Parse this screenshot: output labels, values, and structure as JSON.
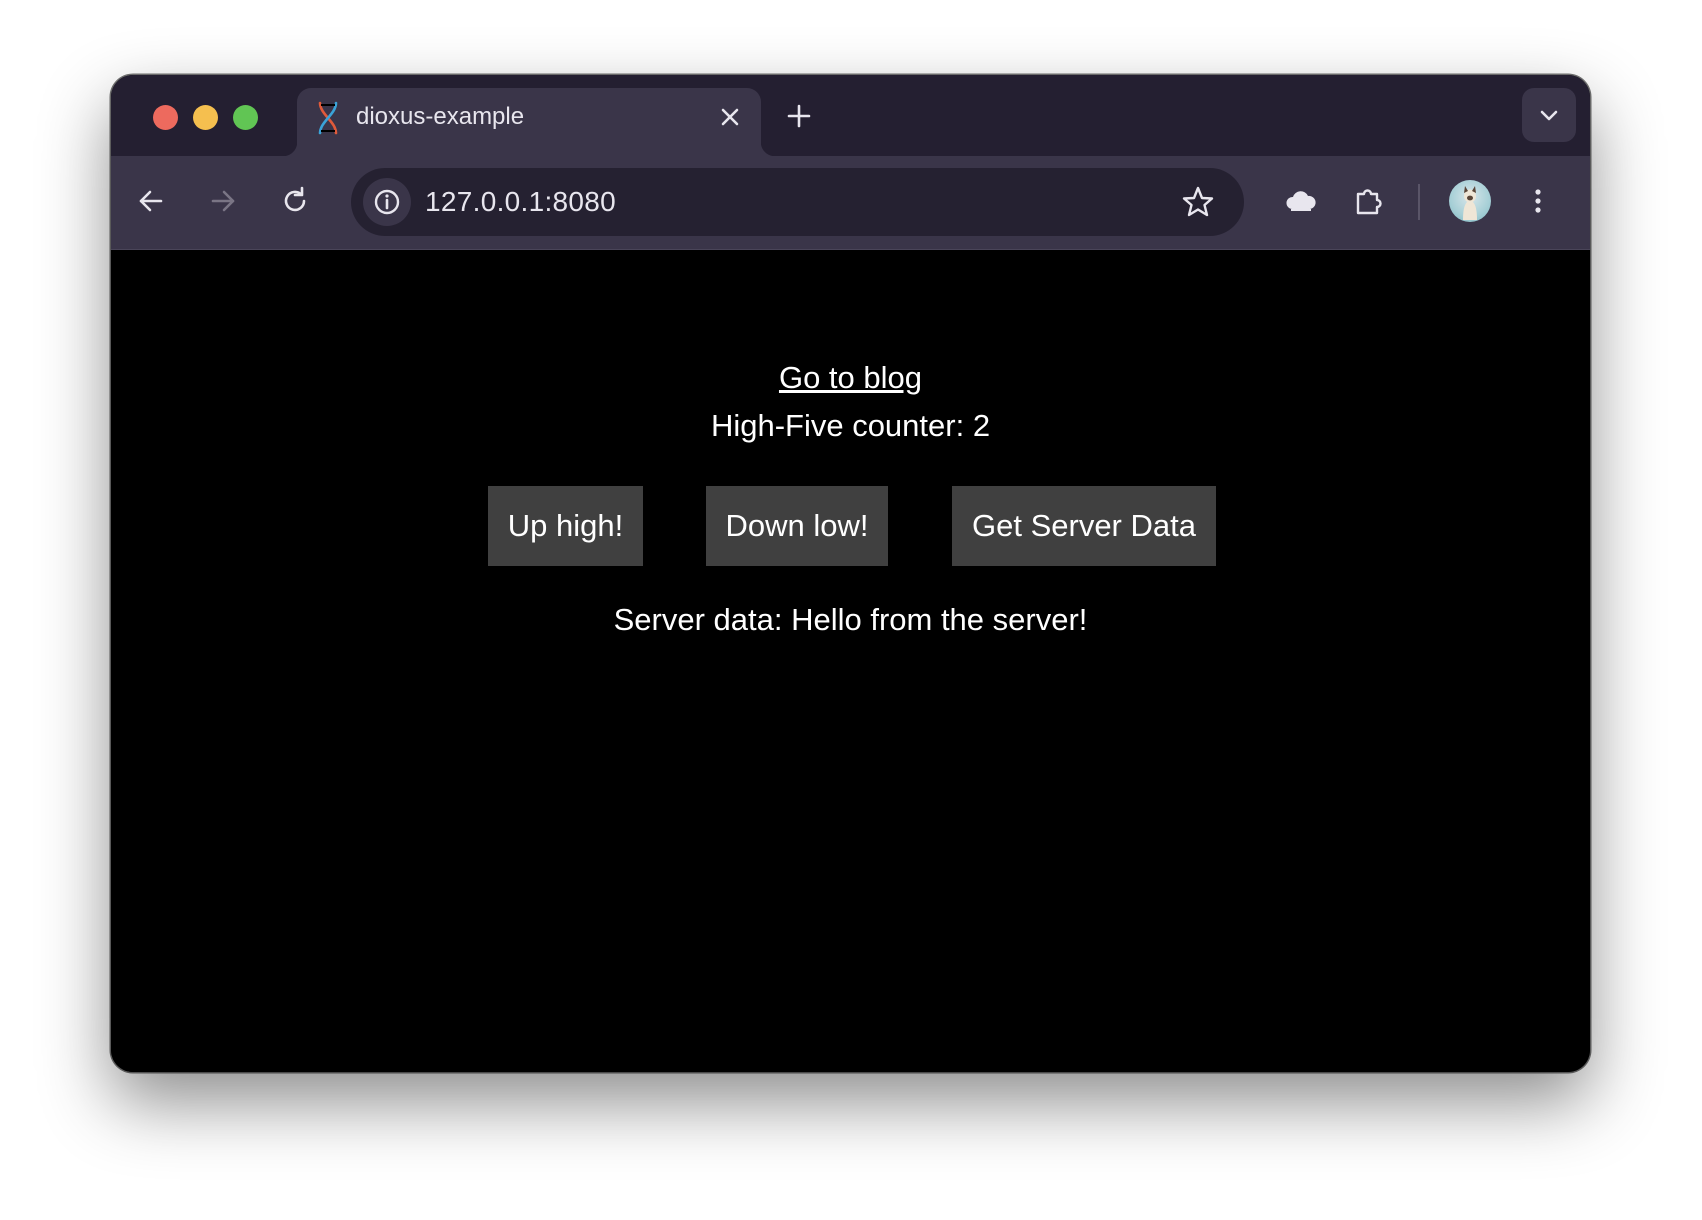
{
  "browser": {
    "tab_title": "dioxus-example",
    "url": "127.0.0.1:8080"
  },
  "page": {
    "blog_link": "Go to blog",
    "counter_text": "High-Five counter: 2",
    "buttons": {
      "up": "Up high!",
      "down": "Down low!",
      "server": "Get Server Data"
    },
    "server_data_text": "Server data: Hello from the server!"
  },
  "colors": {
    "titlebar": "#241f31",
    "toolbar": "#3a3549",
    "omnibox": "#252131",
    "content_bg": "#000000",
    "button_bg": "#404040",
    "traffic_red": "#ed6a5e",
    "traffic_yellow": "#f5bf4f",
    "traffic_green": "#61c554"
  },
  "icons": [
    "close-window-icon",
    "minimize-window-icon",
    "zoom-window-icon",
    "dioxus-favicon-icon",
    "close-tab-icon",
    "new-tab-icon",
    "tab-search-chevron-icon",
    "back-arrow-icon",
    "forward-arrow-icon",
    "reload-icon",
    "site-info-icon",
    "bookmark-star-icon",
    "cloud-extension-icon",
    "extensions-puzzle-icon",
    "profile-avatar",
    "menu-kebab-icon"
  ]
}
